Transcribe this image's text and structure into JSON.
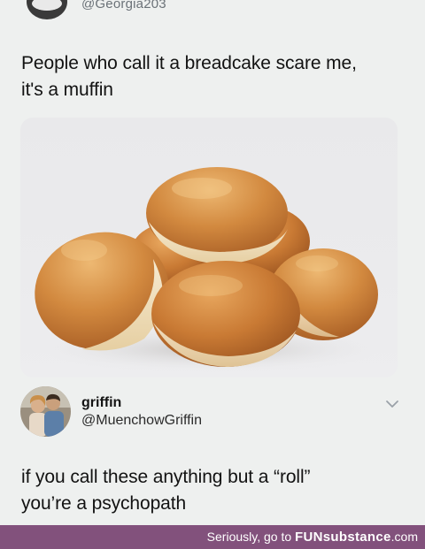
{
  "top_tweet": {
    "handle": "@Georgia203",
    "text_line1": "People who call it a breadcake scare me,",
    "text_line2": "it's a muffin"
  },
  "reply": {
    "name": "griffin",
    "handle": "@MuenchowGriffin",
    "text_line1": "if you call these anything but a “roll”",
    "text_line2": "you’re a psychopath"
  },
  "icons": {
    "more": "chevron-down-icon"
  },
  "footer": {
    "prefix": "Seriously, go to ",
    "brand": "FUNsubstance",
    "suffix": ".com"
  },
  "colors": {
    "footer_bg": "#82517c",
    "handle_gray": "#6b7278",
    "bun_crust": "#c8752f",
    "bun_light": "#f0e0bf"
  }
}
